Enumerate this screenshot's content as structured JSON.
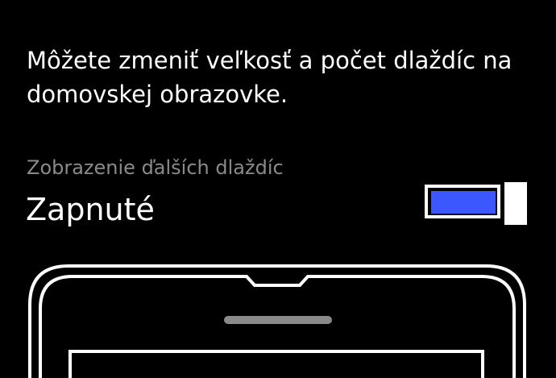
{
  "description": "Môžete zmeniť veľkosť a počet dlaždíc na domovskej obrazovke.",
  "setting": {
    "label": "Zobrazenie ďalších dlaždíc",
    "state": "Zapnuté",
    "enabled": true
  },
  "colors": {
    "background": "#000000",
    "accent": "#3d57ff",
    "foreground": "#ffffff",
    "label": "#8a8a8a"
  },
  "illustration": {
    "icon": "phone-preview-icon"
  }
}
